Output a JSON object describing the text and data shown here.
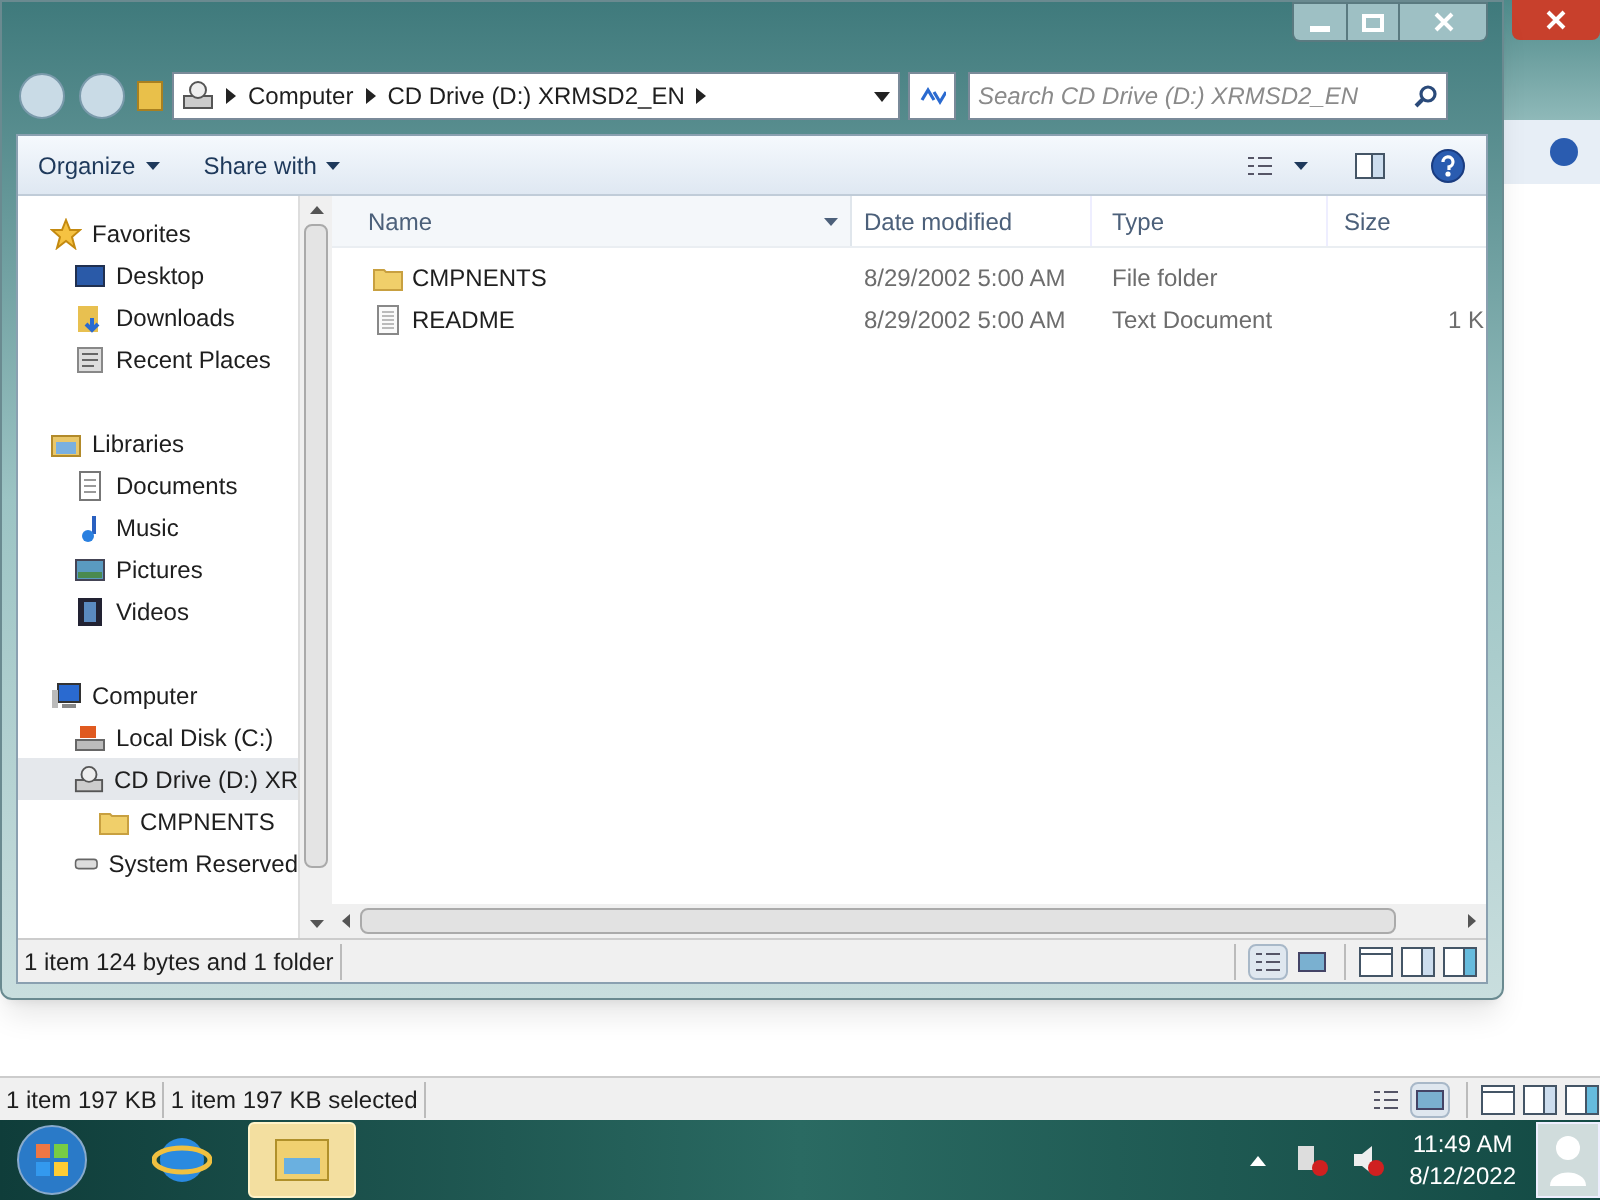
{
  "address": {
    "crumbs": [
      "Computer",
      "CD Drive (D:) XRMSD2_EN"
    ]
  },
  "search": {
    "placeholder": "Search CD Drive (D:) XRMSD2_EN"
  },
  "toolbar": [
    "Organize",
    "Share with"
  ],
  "sidebar": [
    {
      "label": "Favorites",
      "kind": "star",
      "children": [
        {
          "label": "Desktop",
          "kind": "desktop",
          "selected": false
        },
        {
          "label": "Downloads",
          "kind": "downloads",
          "selected": false
        },
        {
          "label": "Recent Places",
          "kind": "recent",
          "selected": false
        }
      ]
    },
    {
      "label": "Libraries",
      "kind": "library",
      "children": [
        {
          "label": "Documents",
          "kind": "document",
          "selected": false
        },
        {
          "label": "Music",
          "kind": "music",
          "selected": false
        },
        {
          "label": "Pictures",
          "kind": "picture",
          "selected": false
        },
        {
          "label": "Videos",
          "kind": "video",
          "selected": false
        }
      ]
    },
    {
      "label": "Computer",
      "kind": "computer",
      "children": [
        {
          "label": "Local Disk (C:)",
          "kind": "disk",
          "selected": false
        },
        {
          "label": "CD Drive (D:) XR",
          "kind": "cd",
          "selected": true,
          "children": [
            {
              "label": "CMPNENTS",
              "kind": "folder",
              "selected": false
            }
          ]
        },
        {
          "label": "System Reserved",
          "kind": "drive",
          "selected": false
        }
      ]
    }
  ],
  "columns": [
    "Name",
    "Date modified",
    "Type",
    "Size"
  ],
  "rows": [
    {
      "name": "CMPNENTS",
      "date": "8/29/2002 5:00 AM",
      "type": "File folder",
      "kind": "folder"
    },
    {
      "name": "README",
      "date": "8/29/2002 5:00 AM",
      "type": "Text Document",
      "size": "1 K",
      "kind": "text"
    }
  ],
  "status_bar": {
    "text": "1 item 124 bytes and 1 folder",
    "views": [
      {
        "kind": "details",
        "selected": true
      },
      {
        "kind": "preview",
        "selected": false
      }
    ]
  },
  "background_window": {
    "status": [
      "1 item 197 KB",
      "1 item 197 KB selected"
    ],
    "views": [
      {
        "kind": "details",
        "selected": false
      },
      {
        "kind": "preview",
        "selected": true
      }
    ]
  },
  "taskbar": {
    "apps": [
      {
        "kind": "browser",
        "selected": false
      },
      {
        "kind": "explorer",
        "selected": true
      }
    ],
    "time": "11:49 AM",
    "date": "8/12/2022"
  }
}
